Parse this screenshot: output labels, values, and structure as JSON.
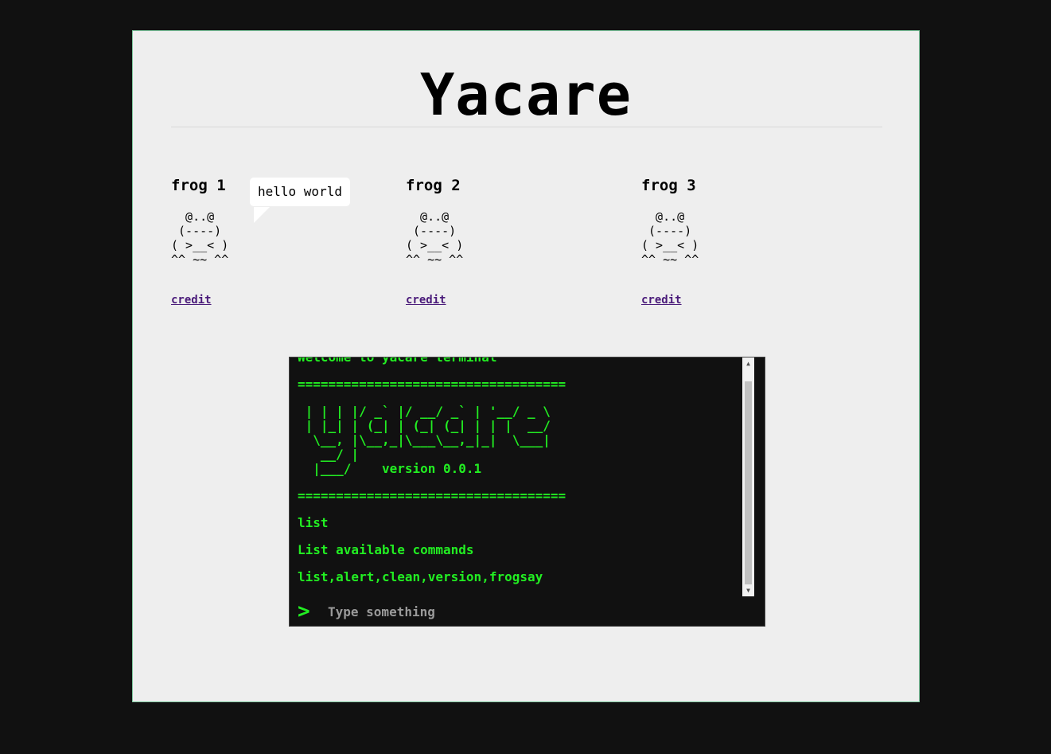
{
  "page": {
    "title": "Yacare"
  },
  "frogs": [
    {
      "name": "frog 1",
      "art": "  @..@\n (----)\n( >__< )\n^^ ~~ ^^",
      "link": "credit",
      "bubble": "hello world"
    },
    {
      "name": "frog 2",
      "art": "  @..@\n (----)\n( >__< )\n^^ ~~ ^^",
      "link": "credit"
    },
    {
      "name": "frog 3",
      "art": "  @..@\n (----)\n( >__< )\n^^ ~~ ^^",
      "link": "credit"
    }
  ],
  "terminal": {
    "welcome": "Welcome to yacare terminal",
    "separator": "===================================",
    "logo": " | | | |/ _` |/ __/ _` | '__/ _ \\\n | |_| | (_| | (_| (_| | | |  __/\n  \\__, |\\__,_|\\___\\__,_|_|  \\___|\n   __/ |\n  |___/    version 0.0.1",
    "separator2": "===================================",
    "history": [
      "list",
      "List available commands",
      "list,alert,clean,version,frogsay"
    ],
    "prompt_symbol": ">",
    "input_placeholder": "Type something",
    "input_value": ""
  },
  "colors": {
    "terminal_text": "#22ee22",
    "link": "#4a1b7a",
    "page_bg": "#eeeeee",
    "outer_bg": "#111111"
  }
}
